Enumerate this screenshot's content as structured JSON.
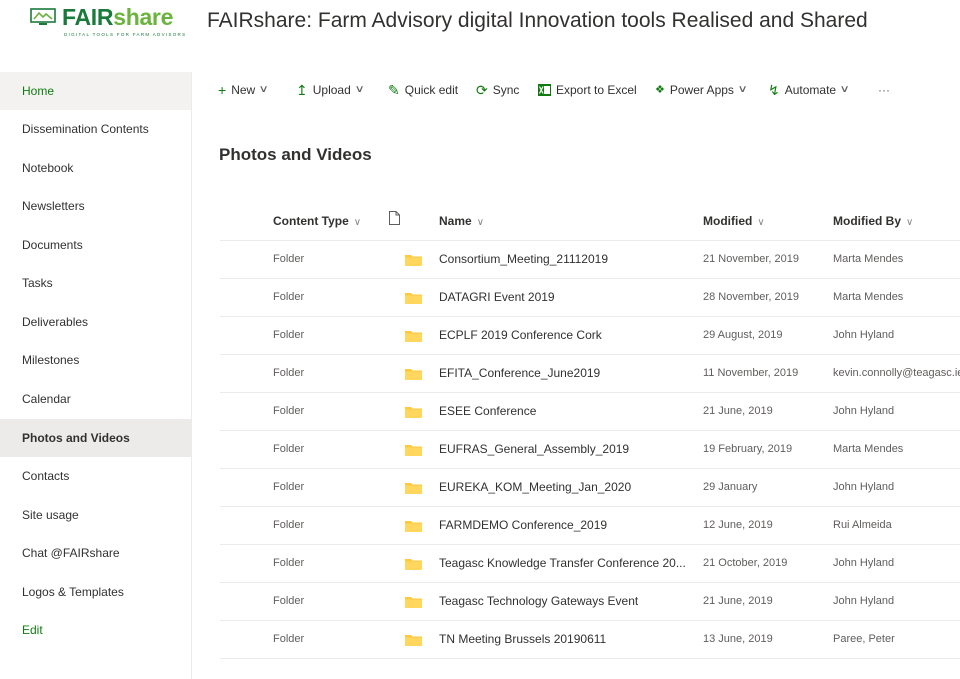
{
  "logo": {
    "word_a": "FAIR",
    "word_b": "share",
    "tagline": "DIGITAL TOOLS FOR FARM ADVISORS"
  },
  "site_title": "FAIRshare: Farm Advisory digital Innovation tools Realised and Shared",
  "colors": {
    "accent": "#107c10",
    "logo_dark": "#1a7a3c",
    "logo_light": "#6ab43e",
    "folder": "#ffc93c",
    "selected_bg": "#edebe9"
  },
  "nav": {
    "items": [
      {
        "label": "Home"
      },
      {
        "label": "Dissemination Contents"
      },
      {
        "label": "Notebook"
      },
      {
        "label": "Newsletters"
      },
      {
        "label": "Documents"
      },
      {
        "label": "Tasks"
      },
      {
        "label": "Deliverables"
      },
      {
        "label": "Milestones"
      },
      {
        "label": "Calendar"
      },
      {
        "label": "Photos and Videos"
      },
      {
        "label": "Contacts"
      },
      {
        "label": "Site usage"
      },
      {
        "label": "Chat @FAIRshare"
      },
      {
        "label": "Logos & Templates"
      },
      {
        "label": "Edit"
      }
    ],
    "selected": "Photos and Videos"
  },
  "commands": {
    "new": "New",
    "upload": "Upload",
    "quick_edit": "Quick edit",
    "sync": "Sync",
    "export": "Export to Excel",
    "power_apps": "Power Apps",
    "automate": "Automate",
    "more": "···"
  },
  "page_title": "Photos and Videos",
  "list": {
    "headers": {
      "content_type": "Content Type",
      "name": "Name",
      "modified": "Modified",
      "modified_by": "Modified By"
    },
    "rows": [
      {
        "content_type": "Folder",
        "name": "Consortium_Meeting_21112019",
        "modified": "21 November, 2019",
        "modified_by": "Marta Mendes"
      },
      {
        "content_type": "Folder",
        "name": "DATAGRI Event 2019",
        "modified": "28 November, 2019",
        "modified_by": "Marta Mendes"
      },
      {
        "content_type": "Folder",
        "name": "ECPLF 2019 Conference Cork",
        "modified": "29 August, 2019",
        "modified_by": "John Hyland"
      },
      {
        "content_type": "Folder",
        "name": "EFITA_Conference_June2019",
        "modified": "11 November, 2019",
        "modified_by": "kevin.connolly@teagasc.ie"
      },
      {
        "content_type": "Folder",
        "name": "ESEE Conference",
        "modified": "21 June, 2019",
        "modified_by": "John Hyland"
      },
      {
        "content_type": "Folder",
        "name": "EUFRAS_General_Assembly_2019",
        "modified": "19 February, 2019",
        "modified_by": "Marta Mendes"
      },
      {
        "content_type": "Folder",
        "name": "EUREKA_KOM_Meeting_Jan_2020",
        "modified": "29 January",
        "modified_by": "John Hyland"
      },
      {
        "content_type": "Folder",
        "name": "FARMDEMO Conference_2019",
        "modified": "12 June, 2019",
        "modified_by": "Rui Almeida"
      },
      {
        "content_type": "Folder",
        "name": "Teagasc Knowledge Transfer Conference 20...",
        "modified": "21 October, 2019",
        "modified_by": "John Hyland"
      },
      {
        "content_type": "Folder",
        "name": "Teagasc Technology Gateways Event",
        "modified": "21 June, 2019",
        "modified_by": "John Hyland"
      },
      {
        "content_type": "Folder",
        "name": "TN Meeting Brussels 20190611",
        "modified": "13 June, 2019",
        "modified_by": "Paree, Peter"
      }
    ]
  }
}
